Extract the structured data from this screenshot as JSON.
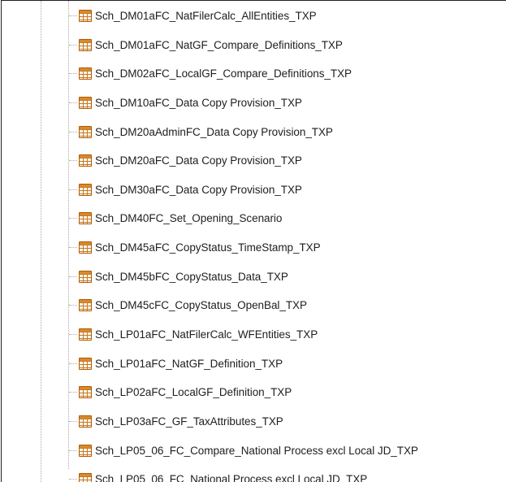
{
  "tree": {
    "items": [
      {
        "label": "Sch_DM01aFC_NatFilerCalc_AllEntities_TXP",
        "icon": "table-icon"
      },
      {
        "label": "Sch_DM01aFC_NatGF_Compare_Definitions_TXP",
        "icon": "table-icon"
      },
      {
        "label": "Sch_DM02aFC_LocalGF_Compare_Definitions_TXP",
        "icon": "table-icon"
      },
      {
        "label": "Sch_DM10aFC_Data Copy Provision_TXP",
        "icon": "table-icon"
      },
      {
        "label": "Sch_DM20aAdminFC_Data Copy Provision_TXP",
        "icon": "table-icon"
      },
      {
        "label": "Sch_DM20aFC_Data Copy Provision_TXP",
        "icon": "table-icon"
      },
      {
        "label": "Sch_DM30aFC_Data Copy Provision_TXP",
        "icon": "table-icon"
      },
      {
        "label": "Sch_DM40FC_Set_Opening_Scenario",
        "icon": "table-icon"
      },
      {
        "label": "Sch_DM45aFC_CopyStatus_TimeStamp_TXP",
        "icon": "table-icon"
      },
      {
        "label": "Sch_DM45bFC_CopyStatus_Data_TXP",
        "icon": "table-icon"
      },
      {
        "label": "Sch_DM45cFC_CopyStatus_OpenBal_TXP",
        "icon": "table-icon"
      },
      {
        "label": "Sch_LP01aFC_NatFilerCalc_WFEntities_TXP",
        "icon": "table-icon"
      },
      {
        "label": "Sch_LP01aFC_NatGF_Definition_TXP",
        "icon": "table-icon"
      },
      {
        "label": "Sch_LP02aFC_LocalGF_Definition_TXP",
        "icon": "table-icon"
      },
      {
        "label": "Sch_LP03aFC_GF_TaxAttributes_TXP",
        "icon": "table-icon"
      },
      {
        "label": "Sch_LP05_06_FC_Compare_National Process excl Local JD_TXP",
        "icon": "table-icon"
      },
      {
        "label": "Sch_LP05_06_FC_National Process excl Local JD_TXP",
        "icon": "table-icon"
      }
    ]
  },
  "colors": {
    "text": "#1e1e1e",
    "guide_lines": "#a9a9a9",
    "icon_accent": "#d88a2c",
    "border": "#1f1f1f"
  }
}
